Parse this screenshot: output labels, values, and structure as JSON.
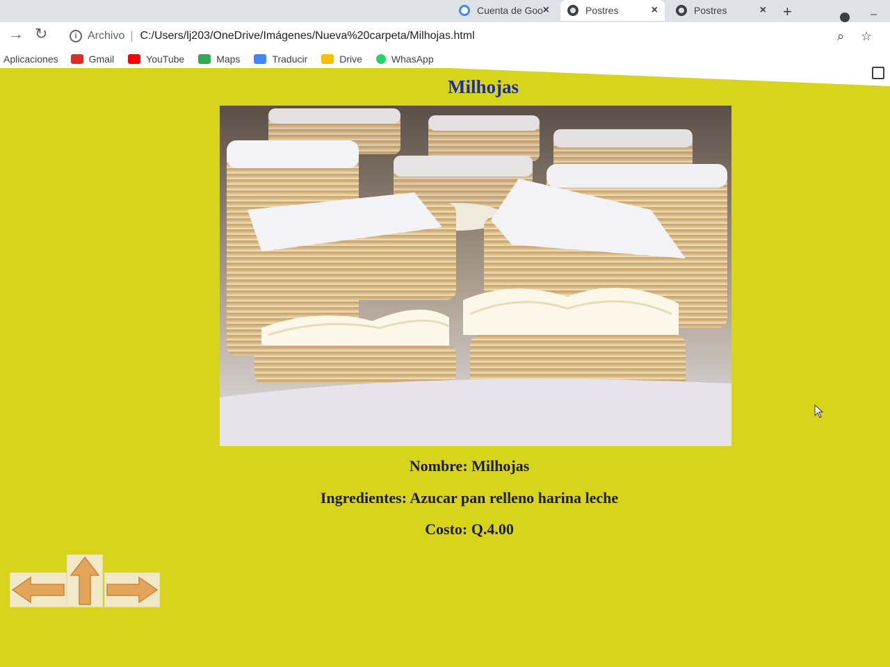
{
  "tabs": [
    {
      "label": "Cuenta de Goo",
      "close": "×"
    },
    {
      "label": "Postres",
      "close": "×"
    },
    {
      "label": "Postres",
      "close": "×"
    }
  ],
  "new_tab": "+",
  "address_bar": {
    "scheme_label": "Archivo",
    "separator": "|",
    "url": "C:/Users/lj203/OneDrive/Imágenes/Nueva%20carpeta/Milhojas.html"
  },
  "bookmarks": [
    {
      "label": "Aplicaciones"
    },
    {
      "label": "Gmail",
      "color": "#d93025"
    },
    {
      "label": "YouTube",
      "color": "#ff0000"
    },
    {
      "label": "Maps",
      "color": "#34a853"
    },
    {
      "label": "Traducir",
      "color": "#4285f4"
    },
    {
      "label": "Drive",
      "color": "#fbbc04"
    },
    {
      "label": "WhasApp",
      "color": "#25d366"
    }
  ],
  "page": {
    "title": "Milhojas",
    "nombre": "Nombre: Milhojas",
    "ingredientes": "Ingredientes: Azucar pan relleno harina leche",
    "costo": "Costo: Q.4.00"
  },
  "colors": {
    "page_background": "#d8d41c",
    "title_color": "#1a2ca8",
    "arrow_color": "#e3a55a"
  },
  "nav_arrows": [
    "left-arrow-icon",
    "up-arrow-icon",
    "right-arrow-icon"
  ]
}
